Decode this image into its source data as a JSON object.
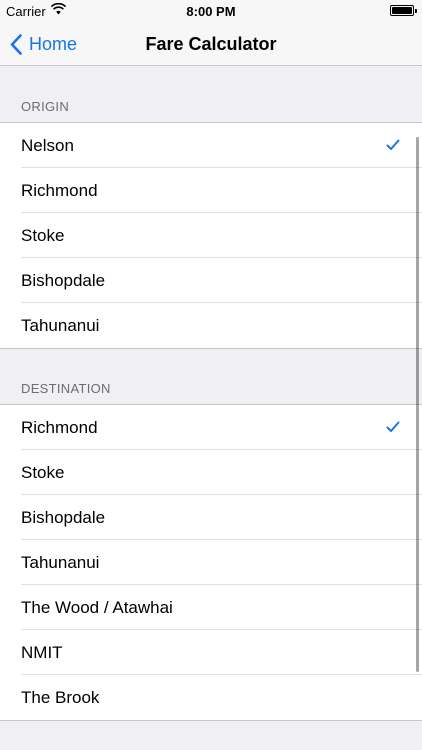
{
  "status_bar": {
    "carrier": "Carrier",
    "time": "8:00 PM"
  },
  "nav": {
    "back_label": "Home",
    "title": "Fare Calculator"
  },
  "origin": {
    "header": "ORIGIN",
    "items": [
      "Nelson",
      "Richmond",
      "Stoke",
      "Bishopdale",
      "Tahunanui"
    ],
    "selected_index": 0
  },
  "destination": {
    "header": "DESTINATION",
    "items": [
      "Richmond",
      "Stoke",
      "Bishopdale",
      "Tahunanui",
      "The Wood / Atawhai",
      "NMIT",
      "The Brook"
    ],
    "selected_index": 0
  },
  "colors": {
    "accent": "#1a73e8",
    "background": "#efeff4"
  }
}
